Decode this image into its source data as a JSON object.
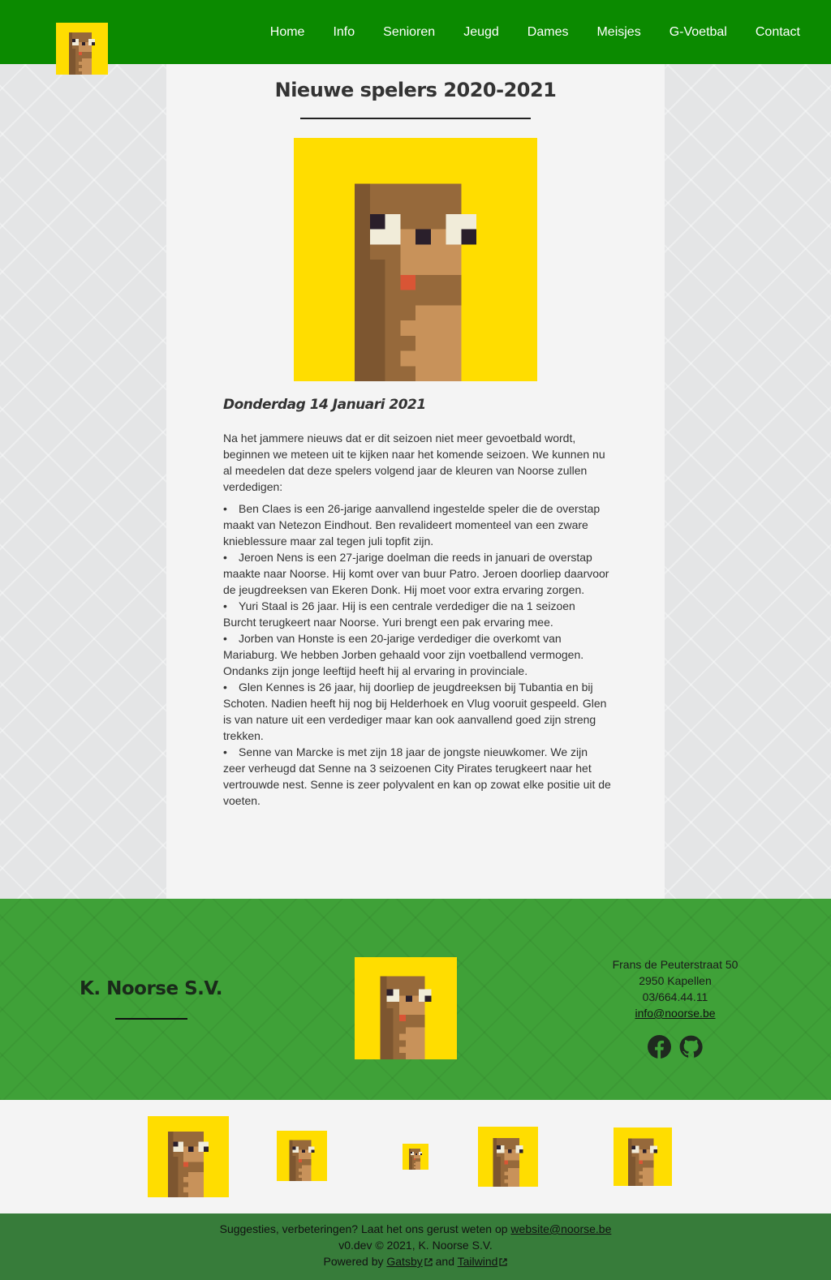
{
  "nav": {
    "links": [
      "Home",
      "Info",
      "Senioren",
      "Jeugd",
      "Dames",
      "Meisjes",
      "G-Voetbal",
      "Contact"
    ]
  },
  "post": {
    "title": "Nieuwe spelers 2020-2021",
    "date": "Donderdag 14 Januari 2021",
    "intro": "Na het jammere nieuws dat er dit seizoen niet meer gevoetbald wordt, beginnen we meteen uit te kijken naar het komende seizoen. We kunnen nu al meedelen dat deze spelers volgend jaar de kleuren van Noorse zullen verdedigen:",
    "bullet": "•",
    "items": [
      "Ben Claes is een 26-jarige aanvallend ingestelde speler die de overstap maakt van Netezon Eindhout. Ben revalideert momenteel van een zware knieblessure maar zal tegen juli topfit zijn.",
      "Jeroen Nens is een 27-jarige doelman die reeds in januari de overstap maakte naar Noorse. Hij komt over van buur Patro. Jeroen doorliep daarvoor de jeugdreeksen van Ekeren Donk. Hij moet voor extra ervaring zorgen.",
      "Yuri Staal is 26 jaar. Hij is een centrale verdediger die na 1 seizoen Burcht terugkeert naar Noorse. Yuri brengt een pak ervaring mee.",
      "Jorben van Honste is een 20-jarige verdediger die overkomt van Mariaburg. We hebben Jorben gehaald voor zijn voetballend vermogen. Ondanks zijn jonge leeftijd heeft hij al ervaring in provinciale.",
      "Glen Kennes is 26 jaar, hij doorliep de jeugdreeksen bij Tubantia en bij Schoten. Nadien heeft hij nog bij Helderhoek en Vlug vooruit gespeeld. Glen is van nature uit een verdediger maar kan ook aanvallend goed zijn streng trekken.",
      "Senne van Marcke is met zijn 18 jaar de jongste nieuwkomer. We zijn zeer verheugd dat Senne na 3 seizoenen City Pirates terugkeert naar het vertrouwde nest. Senne is zeer polyvalent en kan op zowat elke positie uit de voeten."
    ]
  },
  "footer": {
    "club_name": "K. Noorse S.V.",
    "address_line1": "Frans de Peuterstraat 50",
    "address_line2": "2950 Kapellen",
    "phone": "03/664.44.11",
    "email": "info@noorse.be",
    "social_icons": [
      "facebook-icon",
      "github-icon"
    ]
  },
  "bottom": {
    "suggest_text": "Suggesties, verbeteringen? Laat het ons gerust weten op",
    "suggest_email": "website@noorse.be",
    "copyright": "v0.dev © 2021, K. Noorse S.V.",
    "powered_by": "Powered by",
    "gatsby": "Gatsby",
    "and": "and",
    "tailwind": "Tailwind"
  },
  "colors": {
    "nav_green": "#0b8a00",
    "footer_green": "#3fa138",
    "bottom_green": "#377c3a",
    "mascot_yellow": "#ffdd00",
    "mascot_brown": "#96693b"
  }
}
